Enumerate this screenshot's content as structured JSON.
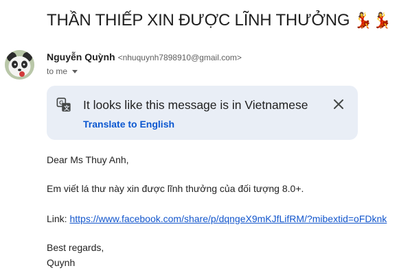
{
  "subject": "THẦN THIẾP XIN ĐƯỢC LĨNH THƯỞNG",
  "subject_emoji": "💃💃",
  "sender": {
    "name": "Nguyễn Quỳnh",
    "email": "<nhuquynh7898910@gmail.com>",
    "recipient": "to me"
  },
  "translate": {
    "message": "It looks like this message is in Vietnamese",
    "action": "Translate to English",
    "icons": [
      "translate-icon",
      "close-icon"
    ]
  },
  "body": {
    "greeting": "Dear Ms Thuy Anh,",
    "main": "Em viết lá thư này xin được lĩnh thưởng của đối tượng 8.0+.",
    "link_label": "Link: ",
    "link_url": "https://www.facebook.com/share/p/dqngeX9mKJfLifRM/?mibextid=oFDknk",
    "regards": "Best regards,",
    "signature": "Quynh"
  },
  "colors": {
    "link": "#1155cc",
    "translate_link": "#0b57d0",
    "banner_bg": "#e9eef6"
  }
}
